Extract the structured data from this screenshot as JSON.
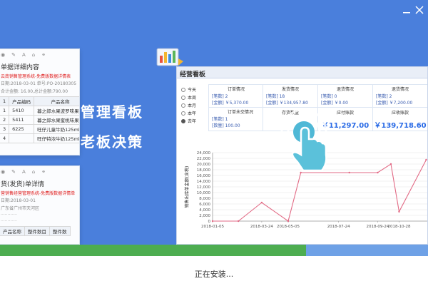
{
  "window": {
    "minimize_icon": "minimize-icon",
    "close_icon": "close-icon"
  },
  "slogans": {
    "line1": "管理看板",
    "line2": "老板决策"
  },
  "card_top": {
    "title": "单据详细内容",
    "red_line": "云南销售管理系统-免费版数据详情表",
    "info_line": "日期:2018-03-01 单号:PO-20180305",
    "total_line": "合计金额: 16.00,总计金额:790.00",
    "headers": [
      "1",
      "产品编码",
      "产品名称"
    ],
    "rows": [
      [
        "1",
        "5410",
        "暮之郎水果波罗味果冻"
      ],
      [
        "2",
        "5411",
        "暮之郎水果蜜桃味果冻"
      ],
      [
        "3",
        "6225",
        "旺仔儿童牛奶125ml"
      ],
      [
        "4",
        "",
        "旺仔特浓牛奶125ml"
      ]
    ]
  },
  "card_bottom": {
    "title": "货(发货)单详情",
    "red_line": "营销售经营管理系统-免费版数据详情单",
    "info_line": "日期:2018-03-01",
    "addr_line": "广东省广州市天河区",
    "headers": [
      "产品名称",
      "整件数目",
      "整件数"
    ]
  },
  "dashboard": {
    "title": "经营看板",
    "periods": [
      "今天",
      "本周",
      "本月",
      "本年",
      "去年"
    ],
    "selected_period": "去年",
    "stats": {
      "order": {
        "title": "订单情况",
        "l1": "[笔数] 2",
        "l2": "[金额] ￥5,370.00"
      },
      "ship": {
        "title": "发货情况",
        "l1": "[笔数] 18",
        "l2": "[金额] ￥134,957.80"
      },
      "return1": {
        "title": "退货情况",
        "l1": "[笔数] 0",
        "l2": "[金额] ￥0.00"
      },
      "return2": {
        "title": "退货情况",
        "l1": "[笔数] 2",
        "l2": "[金额] ￥7,200.00"
      },
      "pending": {
        "title": "订单未交情况",
        "l1": "[笔数] 1",
        "l2": "[数量] 100.00"
      },
      "inventory": {
        "title": "存货数量"
      },
      "receivable": {
        "title": "应付账款",
        "value": "￥11,297.00"
      },
      "payable": {
        "title": "应收账款",
        "value": "￥139,718.60"
      }
    }
  },
  "chart_data": {
    "type": "line",
    "ylabel": "销售出库单金额(含税)",
    "ylim": [
      0,
      24000
    ],
    "yticks": [
      "0",
      "2,000",
      "4,000",
      "6,000",
      "8,000",
      "10,000",
      "12,000",
      "14,000",
      "16,000",
      "18,000",
      "20,000",
      "22,000",
      "24,000"
    ],
    "xticks": [
      "2018-01-05",
      "2018-03-24",
      "2018-05-05",
      "2018-07-24",
      "2018-09-24",
      "2018-10-28"
    ],
    "series_color": "#e26a85",
    "points": [
      {
        "x": "2018-01-05",
        "y": 0
      },
      {
        "x": "2018-02-15",
        "y": 0
      },
      {
        "x": "2018-03-24",
        "y": 6500
      },
      {
        "x": "2018-05-05",
        "y": 0
      },
      {
        "x": "2018-05-25",
        "y": 17000
      },
      {
        "x": "2018-08-10",
        "y": 17000
      },
      {
        "x": "2018-09-24",
        "y": 17000
      },
      {
        "x": "2018-10-15",
        "y": 20000
      },
      {
        "x": "2018-10-28",
        "y": 3300
      },
      {
        "x": "2018-12-10",
        "y": 21500
      }
    ]
  },
  "progress": {
    "fraction": 0.715,
    "fill_color": "#4dad50",
    "track_color": "#6ea1e6"
  },
  "status_text": "正在安装..."
}
